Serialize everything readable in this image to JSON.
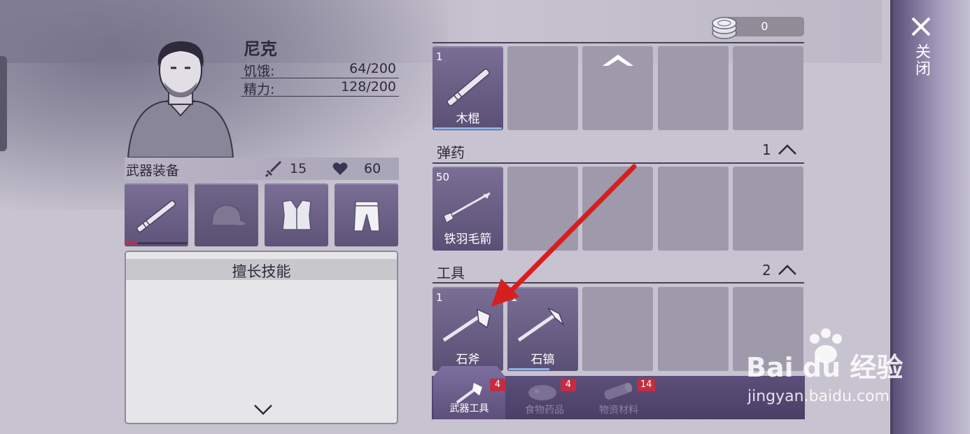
{
  "character": {
    "name": "尼克",
    "stats": [
      {
        "label": "饥饿:",
        "value": "64/200"
      },
      {
        "label": "精力:",
        "value": "128/200"
      }
    ]
  },
  "equipment": {
    "title": "武器装备",
    "attack": "15",
    "health": "60",
    "slots": [
      {
        "icon": "wooden-stick-icon"
      },
      {
        "icon": "cap-icon"
      },
      {
        "icon": "vest-icon"
      },
      {
        "icon": "shorts-icon"
      }
    ]
  },
  "skills": {
    "title": "擅长技能"
  },
  "currency": {
    "amount": "0"
  },
  "inventory": {
    "sections": [
      {
        "title": "",
        "items": [
          {
            "count": "1",
            "name": "木棍"
          }
        ]
      },
      {
        "title": "弹药",
        "count": "1",
        "items": [
          {
            "count": "50",
            "name": "铁羽毛箭"
          }
        ]
      },
      {
        "title": "工具",
        "count": "2",
        "items": [
          {
            "count": "1",
            "name": "石斧"
          },
          {
            "count": "1",
            "name": "石镐"
          }
        ]
      }
    ]
  },
  "tabs": [
    {
      "label": "武器工具",
      "badge": "4",
      "active": true
    },
    {
      "label": "食物药品",
      "badge": "4",
      "active": false
    },
    {
      "label": "物资材料",
      "badge": "14",
      "active": false
    }
  ],
  "close": {
    "label": "关闭"
  },
  "watermark": {
    "brand": "Bai du 经验",
    "url": "jingyan.baidu.com"
  },
  "colors": {
    "accent": "#5e5378",
    "badge": "#c62c40",
    "annotation_arrow": "#d61f1f"
  }
}
